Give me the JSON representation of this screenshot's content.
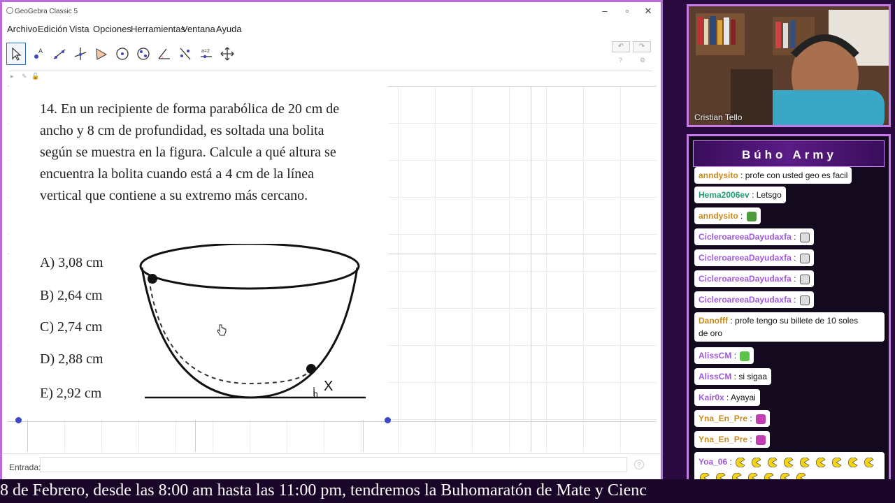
{
  "window": {
    "title": "GeoGebra Classic 5"
  },
  "menu": [
    "Archivo",
    "Edición",
    "Vista",
    "Opciones",
    "Herramientas",
    "Ventana",
    "Ayuda"
  ],
  "toolbar": {
    "tools": [
      "move-tool",
      "point-tool",
      "line-tool",
      "perpendicular-tool",
      "polygon-tool",
      "circle-tool",
      "conic-tool",
      "angle-tool",
      "reflect-tool",
      "slider-tool",
      "move-view-tool"
    ],
    "undo_icon": "undo-icon",
    "redo_icon": "redo-icon"
  },
  "problem": {
    "lines": [
      "14. En un recipiente de forma parabólica de 20 cm de",
      "ancho y 8 cm de profundidad, es soltada una bolita",
      "según se muestra en la figura. Calcule a qué altura se",
      "encuentra la bolita cuando está a 4 cm de la línea",
      "vertical que contiene a su extremo más cercano."
    ],
    "options": [
      "A) 3,08 cm",
      "B) 2,64 cm",
      "C) 2,74 cm",
      "D) 2,88 cm",
      "E) 2,92 cm"
    ],
    "figure_label_x": "X",
    "figure_label_h": "h"
  },
  "input_bar": {
    "label": "Entrada:",
    "value": "",
    "help": "?"
  },
  "webcam": {
    "name": "Cristian Tello"
  },
  "chat": {
    "title": "Búho Army",
    "messages": [
      {
        "user": "anndysito",
        "color": "#c98a1e",
        "text": "profe con usted geo es facil",
        "emote": ""
      },
      {
        "user": "Hema2006ev",
        "color": "#1f9e6e",
        "text": "Letsgo",
        "emote": ""
      },
      {
        "user": "anndysito",
        "color": "#c98a1e",
        "text": "",
        "emote": "pepe-emote"
      },
      {
        "user": "CicleroareeaDayudaxfa",
        "color": "#a05ad6",
        "text": "",
        "emote": "sunglasses-emote"
      },
      {
        "user": "CicleroareeaDayudaxfa",
        "color": "#a05ad6",
        "text": "",
        "emote": "sunglasses-emote"
      },
      {
        "user": "CicleroareeaDayudaxfa",
        "color": "#a05ad6",
        "text": "",
        "emote": "sunglasses-emote"
      },
      {
        "user": "CicleroareeaDayudaxfa",
        "color": "#a05ad6",
        "text": "",
        "emote": "sunglasses-emote"
      },
      {
        "user": "Danofff",
        "color": "#c98a1e",
        "text": "profe tengo su billete de 10 soles",
        "text2": "de oro",
        "emote": ""
      },
      {
        "user": "AlissCM",
        "color": "#a05ad6",
        "text": "",
        "emote": "alien-emote"
      },
      {
        "user": "AlissCM",
        "color": "#a05ad6",
        "text": "si sigaa",
        "emote": ""
      },
      {
        "user": "Kair0x",
        "color": "#a05ad6",
        "text": "Ayayai",
        "emote": ""
      },
      {
        "user": "Yna_En_Pre",
        "color": "#c98a1e",
        "text": "",
        "emote": "pink-emote"
      },
      {
        "user": "Yna_En_Pre",
        "color": "#c98a1e",
        "text": "",
        "emote": "pink-emote"
      },
      {
        "user": "Yoa_06",
        "color": "#a05ad6",
        "text": "",
        "emote": "pacman-emote"
      }
    ]
  },
  "ticker": {
    "text": "8 de Febrero, desde las 8:00 am hasta las 11:00 pm, tendremos la Buhomaratón de Mate y Cienc"
  }
}
